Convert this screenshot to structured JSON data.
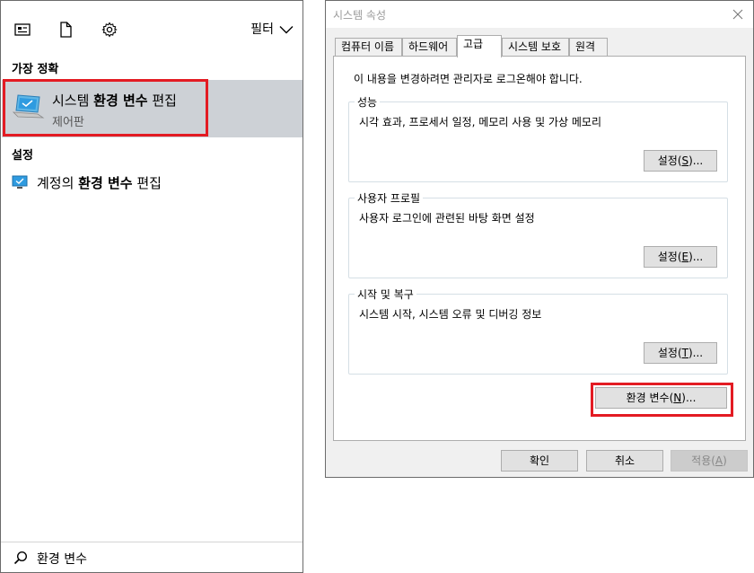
{
  "search_panel": {
    "filter_label": "필터",
    "best_match_heading": "가장 정확",
    "best_match": {
      "title_pre": "시스템 ",
      "title_bold": "환경 변수",
      "title_post": " 편집",
      "subtitle": "제어판"
    },
    "settings_heading": "설정",
    "setting_item": {
      "pre": "계정의 ",
      "bold": "환경 변수",
      "post": " 편집"
    },
    "search_query": "환경 변수"
  },
  "dialog": {
    "title": "시스템 속성",
    "tabs": [
      {
        "label": "컴퓨터 이름"
      },
      {
        "label": "하드웨어"
      },
      {
        "label": "고급"
      },
      {
        "label": "시스템 보호"
      },
      {
        "label": "원격"
      }
    ],
    "active_tab": "고급",
    "admin_note": "이 내용을 변경하려면 관리자로 로그온해야 합니다.",
    "groups": [
      {
        "title": "성능",
        "desc": "시각 효과, 프로세서 일정, 메모리 사용 및 가상 메모리",
        "btn_label": "설정(",
        "btn_key": "S",
        "btn_tail": ")..."
      },
      {
        "title": "사용자 프로필",
        "desc": "사용자 로그인에 관련된 바탕 화면 설정",
        "btn_label": "설정(",
        "btn_key": "E",
        "btn_tail": ")..."
      },
      {
        "title": "시작 및 복구",
        "desc": "시스템 시작, 시스템 오류 및 디버깅 정보",
        "btn_label": "설정(",
        "btn_key": "T",
        "btn_tail": ")..."
      }
    ],
    "env_button": {
      "label": "환경 변수(",
      "key": "N",
      "tail": ")..."
    },
    "footer": {
      "ok": "확인",
      "cancel": "취소",
      "apply_label": "적용(",
      "apply_key": "A",
      "apply_tail": ")"
    }
  },
  "colors": {
    "highlight_box": "#e31b23",
    "selected_row": "#cdd1d6",
    "dialog_bg": "#f0f0f0"
  },
  "icons": {
    "toolbar": [
      "document-view-icon",
      "file-icon",
      "gear-icon"
    ],
    "best_match": "laptop-icon",
    "setting": "monitor-icon",
    "search": "search-icon",
    "filter": "chevron-down-icon",
    "close": "close-icon"
  }
}
